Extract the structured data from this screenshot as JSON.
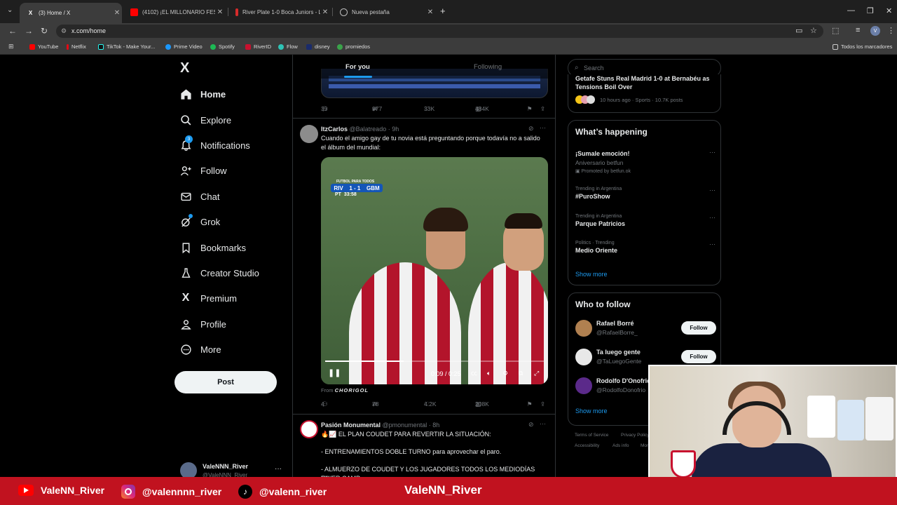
{
  "browser": {
    "tabs": [
      {
        "title": "(3) Home / X",
        "active": true
      },
      {
        "title": "(4102) ¡EL MILLONARIO FESTEJÓ...",
        "active": false
      },
      {
        "title": "River Plate 1-0 Boca Juniors - L...",
        "active": false
      },
      {
        "title": "Nueva pestaña",
        "active": false
      }
    ],
    "url": "x.com/home",
    "bookmarks": [
      "YouTube",
      "Netflix",
      "TikTok - Make Your...",
      "Prime Video",
      "Spotify",
      "RiverID",
      "Flow",
      "disney",
      "promiedos"
    ],
    "all_bookmarks": "Todos los marcadores",
    "profile_initial": "V"
  },
  "x_nav": {
    "logo": "X",
    "items": [
      "Home",
      "Explore",
      "Notifications",
      "Follow",
      "Chat",
      "Grok",
      "Bookmarks",
      "Creator Studio",
      "Premium",
      "Profile",
      "More"
    ],
    "notif_badge": "3",
    "post_button": "Post",
    "account": {
      "name": "ValeNNN_River",
      "handle": "@ValeNNN_River"
    }
  },
  "timeline": {
    "tabs": [
      "For you",
      "Following"
    ],
    "prev_tweet_stats": {
      "replies": "39",
      "reposts": "977",
      "likes": "33K",
      "views": "484K"
    },
    "tweet1": {
      "name": "ItzCarlos",
      "handle": "@Balatreado",
      "time": "9h",
      "text": "Cuando el amigo gay de tu novia está preguntando porque todavía no a salido el álbum del mundial:",
      "scoreboard": {
        "broadcaster": "FUTBOL PARA TODOS",
        "home": "RIV",
        "score": "1 - 1",
        "away": "GBM",
        "period": "PT",
        "clock": "33:58"
      },
      "video_time": "0:09 / 0:25",
      "video_progress": 0.36,
      "from_label": "From",
      "from_source": "CHORIGOL",
      "stats": {
        "replies": "4",
        "reposts": "78",
        "likes": "4.2K",
        "views": "208K"
      }
    },
    "tweet2": {
      "name": "Pasión Monumental",
      "handle": "@pmonumental",
      "time": "8h",
      "line1": "🔥📈 EL PLAN COUDET PARA REVERTIR LA SITUACIÓN:",
      "line2": "- ENTRENAMIENTOS DOBLE TURNO para aprovechar el paro.",
      "line3": "- ALMUERZO DE COUDET Y LOS JUGADORES TODOS LOS MEDIODÍAS EN",
      "line4": "RIVER CAMP."
    }
  },
  "sidebar": {
    "search_placeholder": "Search",
    "top_news": {
      "title": "Getafe Stuns Real Madrid 1-0 at Bernabéu as Tensions Boil Over",
      "meta": "10 hours ago · Sports · 10.7K posts"
    },
    "whats_happening": {
      "title": "What’s happening",
      "items": [
        {
          "name": "¡Sumale emoción!",
          "sub": "Aniversario betfun",
          "promo": "Promoted by betfun.ok"
        },
        {
          "context": "Trending in Argentina",
          "name": "#PuroShow"
        },
        {
          "context": "Trending in Argentina",
          "name": "Parque Patricios"
        },
        {
          "context": "Politics · Trending",
          "name": "Medio Oriente"
        }
      ],
      "show_more": "Show more"
    },
    "who_to_follow": {
      "title": "Who to follow",
      "users": [
        {
          "name": "Rafael Borré",
          "handle": "@RafaelBorre_",
          "button": "Follow"
        },
        {
          "name": "Ta luego gente",
          "handle": "@TaLuegoGente",
          "button": "Follow"
        },
        {
          "name": "Rodolfo D'Onofrio",
          "handle": "@RodolfoDonofrio"
        }
      ],
      "show_more": "Show more"
    },
    "footer": [
      "Terms of Service",
      "Privacy Policy",
      "Accessibility",
      "Ads info",
      "More"
    ]
  },
  "stream_banner": {
    "youtube": "ValeNN_River",
    "instagram": "@valennnn_river",
    "tiktok": "@valenn_river",
    "center": "ValeNN_River",
    "colors": {
      "banner": "#c1121f",
      "youtube": "#ff0000"
    }
  }
}
